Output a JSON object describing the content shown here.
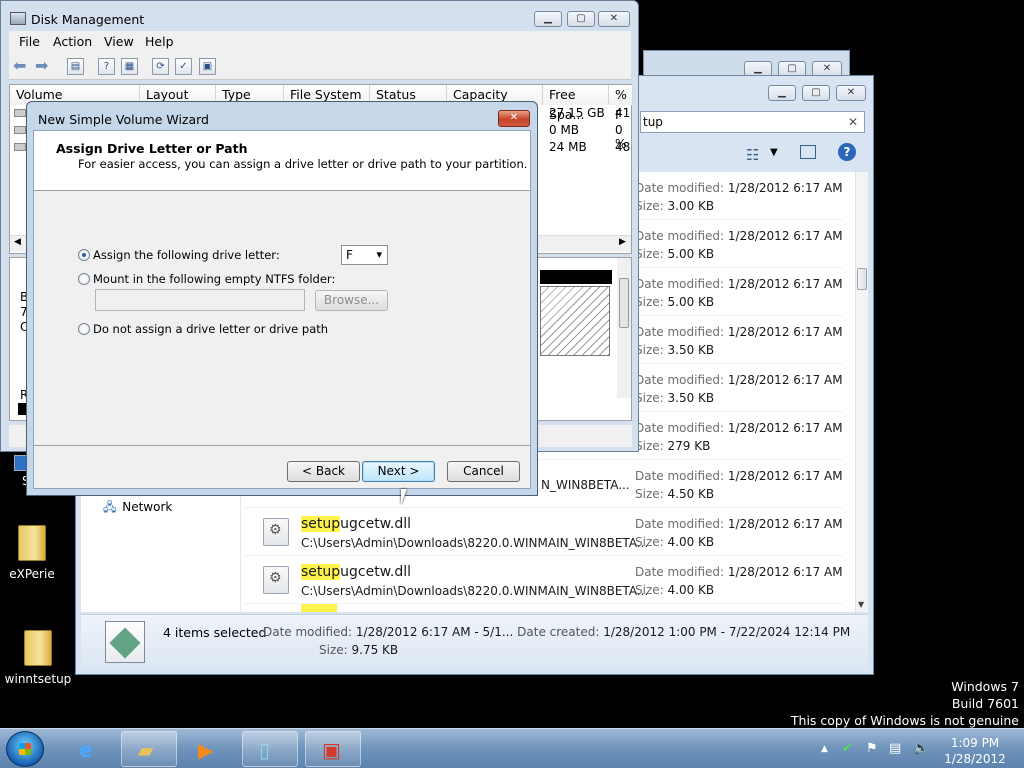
{
  "disk_management": {
    "title": "Disk Management",
    "menu": [
      "File",
      "Action",
      "View",
      "Help"
    ],
    "columns": [
      "Volume",
      "Layout",
      "Type",
      "File System",
      "Status",
      "Capacity",
      "Free Spa...",
      "% F"
    ],
    "free_space": [
      "27.15 GB",
      "0 MB",
      "24 MB"
    ],
    "percent_free": [
      "41",
      "0 %",
      "48"
    ],
    "graph_labels": [
      "B",
      "7(",
      "O",
      "R"
    ]
  },
  "wizard": {
    "title": "New Simple Volume Wizard",
    "heading": "Assign Drive Letter or Path",
    "subheading": "For easier access, you can assign a drive letter or drive path to your partition.",
    "option_assign": "Assign the following drive letter:",
    "drive_letter": "F",
    "option_mount": "Mount in the following empty NTFS folder:",
    "browse_label": "Browse...",
    "option_none": "Do not assign a drive letter or drive path",
    "back_label": "< Back",
    "next_label": "Next >",
    "cancel_label": "Cancel",
    "selected_option": "assign"
  },
  "explorer": {
    "search_text": "tup",
    "nav_network": "Network",
    "date_label": "Date modified:",
    "size_label": "Size:",
    "files": [
      {
        "date": "1/28/2012 6:17 AM",
        "size": "3.00 KB"
      },
      {
        "date": "1/28/2012 6:17 AM",
        "size": "5.00 KB"
      },
      {
        "date": "1/28/2012 6:17 AM",
        "size": "5.00 KB"
      },
      {
        "date": "1/28/2012 6:17 AM",
        "size": "3.50 KB"
      },
      {
        "date": "1/28/2012 6:17 AM",
        "size": "3.50 KB"
      },
      {
        "date": "1/28/2012 6:17 AM",
        "size": "279 KB"
      },
      {
        "date": "1/28/2012 6:17 AM",
        "size": "4.50 KB",
        "path": "N_WIN8BETA..."
      },
      {
        "name_hl": "setup",
        "name_rest": "ugcetw.dll",
        "path": "C:\\Users\\Admin\\Downloads\\8220.0.WINMAIN_WIN8BETA...",
        "date": "1/28/2012 6:17 AM",
        "size": "4.00 KB"
      },
      {
        "name_hl": "setup",
        "name_rest": "ugcetw.dll",
        "path": "C:\\Users\\Admin\\Downloads\\8220.0.WINMAIN_WIN8BETA...",
        "date": "1/28/2012 6:17 AM",
        "size": "4.00 KB"
      }
    ],
    "details": {
      "count": "4 items selected",
      "modified_label": "Date modified:",
      "modified": "1/28/2012 6:17 AM - 5/1...",
      "created_label": "Date created:",
      "created": "1/28/2012 1:00 PM - 7/22/2024 12:14 PM",
      "size_label": "Size:",
      "size": "9.75 KB"
    }
  },
  "desktop": {
    "icons": [
      "eXPerie",
      "winntsetup"
    ],
    "partial_icon": "S",
    "watermark": [
      "Windows 7",
      "Build 7601",
      "This copy of Windows is not genuine"
    ]
  },
  "taskbar": {
    "time": "1:09 PM",
    "date": "1/28/2012"
  }
}
